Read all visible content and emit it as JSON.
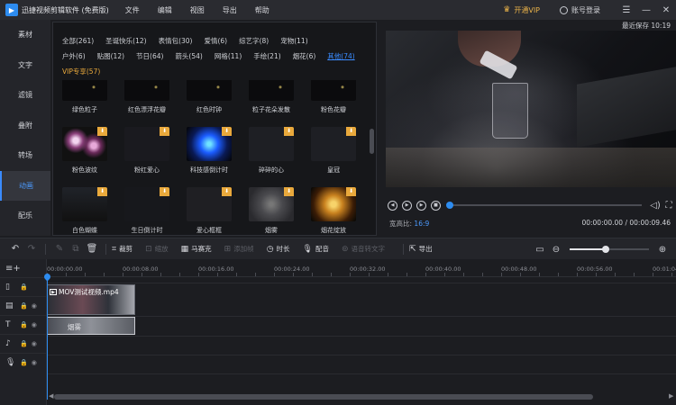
{
  "titlebar": {
    "app_title": "迅捷视频剪辑软件 (免费版)",
    "menus": [
      "文件",
      "编辑",
      "视图",
      "导出",
      "帮助"
    ],
    "vip_label": "开通VIP",
    "login_label": "账号登录",
    "window_controls": [
      "☰",
      "—",
      "✕"
    ]
  },
  "sidebar": {
    "tabs": [
      "素材",
      "文字",
      "滤镜",
      "叠附",
      "转场",
      "动画",
      "配乐"
    ],
    "active": "动画"
  },
  "media": {
    "category_rows": [
      [
        "全部(261)",
        "圣诞快乐(12)",
        "表情包(30)",
        "爱情(6)",
        "综艺字(8)",
        "宠物(11)"
      ],
      [
        "户外(6)",
        "贴图(12)",
        "节日(64)",
        "箭头(54)",
        "网格(11)",
        "手绘(21)",
        "烟花(6)",
        "其他(74)"
      ]
    ],
    "active_category": "其他(74)",
    "vip_category": "VIP专享(57)",
    "tiles": [
      {
        "label": "绿色粒子",
        "style": "t-particles",
        "vip": false
      },
      {
        "label": "红色漂浮花瓣",
        "style": "t-particles",
        "vip": false
      },
      {
        "label": "红色时钟",
        "style": "t-particles",
        "vip": false
      },
      {
        "label": "粒子花朵发散",
        "style": "t-particles",
        "vip": false
      },
      {
        "label": "粉色花瓣",
        "style": "t-particles",
        "vip": false
      },
      {
        "label": "粉色波纹",
        "style": "t-pinkwave",
        "vip": true
      },
      {
        "label": "粉红爱心",
        "style": "t-heart",
        "vip": true
      },
      {
        "label": "科技感倒计时",
        "style": "t-tech",
        "vip": true
      },
      {
        "label": "碎碎的心",
        "style": "t-broken",
        "vip": true
      },
      {
        "label": "皇冠",
        "style": "t-crown",
        "vip": true
      },
      {
        "label": "白色蝴蝶",
        "style": "t-white",
        "vip": true
      },
      {
        "label": "生日倒计时",
        "style": "t-bday",
        "vip": true
      },
      {
        "label": "爱心框框",
        "style": "t-love",
        "vip": true
      },
      {
        "label": "烟雾",
        "style": "t-smoke",
        "vip": true
      },
      {
        "label": "烟花绽放",
        "style": "t-fire",
        "vip": true
      }
    ]
  },
  "preview": {
    "autosave": "最近保存 10:19",
    "ratio_label": "宽高比:",
    "ratio_value": "16:9",
    "timecode": "00:00:00.00 / 00:00:09.46",
    "progress": 0
  },
  "toolbar": {
    "crop": "裁剪",
    "zoom": "缩放",
    "mosaic": "马赛克",
    "add_frame": "添加帧",
    "duration": "时长",
    "dub": "配音",
    "speech_to_text": "语音转文字",
    "export": "导出",
    "zoom_level": 0.45
  },
  "timeline": {
    "ticks": [
      "00:00:00.00",
      "00:00:08.00",
      "00:00:16.00",
      "00:00:24.00",
      "00:00:32.00",
      "00:00:40.00",
      "00:00:48.00",
      "00:00:56.00",
      "00:01:04"
    ],
    "video_clip": "MOV测试视频.mp4",
    "fx_clip": "烟雾"
  },
  "colors": {
    "accent": "#2d8cf0",
    "vip": "#e9a93c"
  }
}
